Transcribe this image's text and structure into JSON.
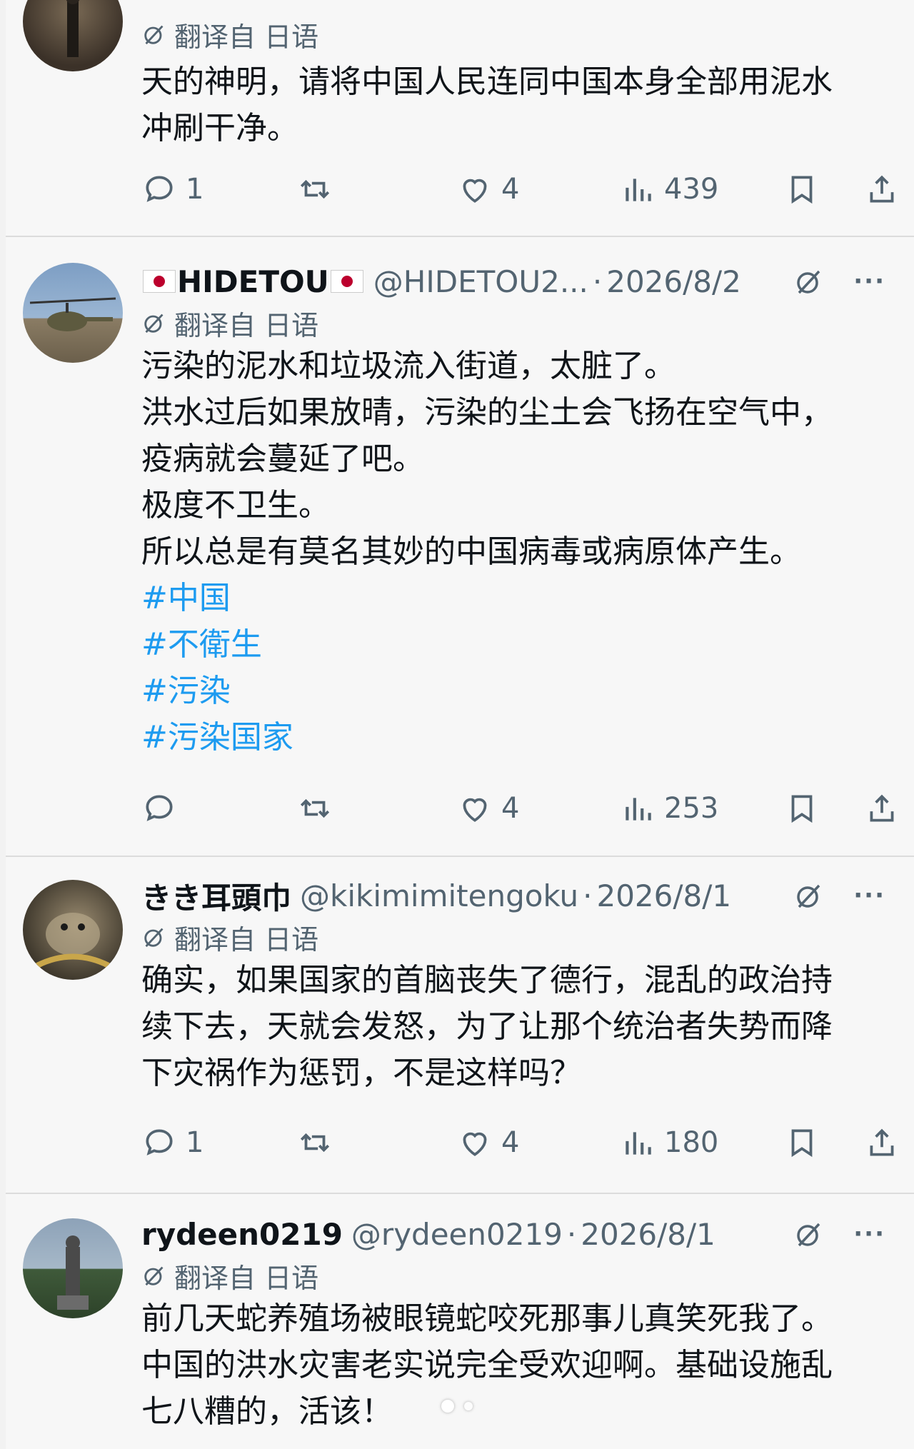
{
  "translate_label": "翻译自 日语",
  "tweets": [
    {
      "name": "",
      "handle": "",
      "date": "",
      "text_lines": [
        "天的神明，请将中国人民连同中国本身全部用泥水",
        "冲刷干净。"
      ],
      "hashtags": [],
      "replies": "1",
      "retweets": "",
      "likes": "4",
      "views": "439"
    },
    {
      "name": "HIDETOU",
      "name_flags": true,
      "handle": "@HIDETOU2...",
      "date": "2026/8/2",
      "text_lines": [
        "污染的泥水和垃圾流入街道，太脏了。",
        "洪水过后如果放晴，污染的尘土会飞扬在空气中，",
        "疫病就会蔓延了吧。",
        "极度不卫生。",
        "所以总是有莫名其妙的中国病毒或病原体产生。"
      ],
      "hashtags": [
        "#中国",
        "#不衛生",
        "#污染",
        "#污染国家"
      ],
      "replies": "",
      "retweets": "",
      "likes": "4",
      "views": "253"
    },
    {
      "name": "きき耳頭巾",
      "handle": "@kikimimitengoku",
      "date": "2026/8/1",
      "text_lines": [
        "确实，如果国家的首脑丧失了德行，混乱的政治持",
        "续下去，天就会发怒，为了让那个统治者失势而降",
        "下灾祸作为惩罚，不是这样吗？"
      ],
      "hashtags": [],
      "replies": "1",
      "retweets": "",
      "likes": "4",
      "views": "180"
    },
    {
      "name": "rydeen0219",
      "handle": "@rydeen0219",
      "date": "2026/8/1",
      "text_lines": [
        "前几天蛇养殖场被眼镜蛇咬死那事儿真笑死我了。",
        "中国的洪水灾害老实说完全受欢迎啊。基础设施乱",
        "七八糟的，活该！"
      ],
      "hashtags": []
    }
  ],
  "colors": {
    "text": "#0f1419",
    "secondary": "#536471",
    "link": "#1d9bf0",
    "background": "#f7f7f7"
  },
  "icons": [
    "reply-icon",
    "retweet-icon",
    "like-icon",
    "views-icon",
    "bookmark-icon",
    "share-icon",
    "grok-icon",
    "more-icon",
    "translate-icon"
  ]
}
